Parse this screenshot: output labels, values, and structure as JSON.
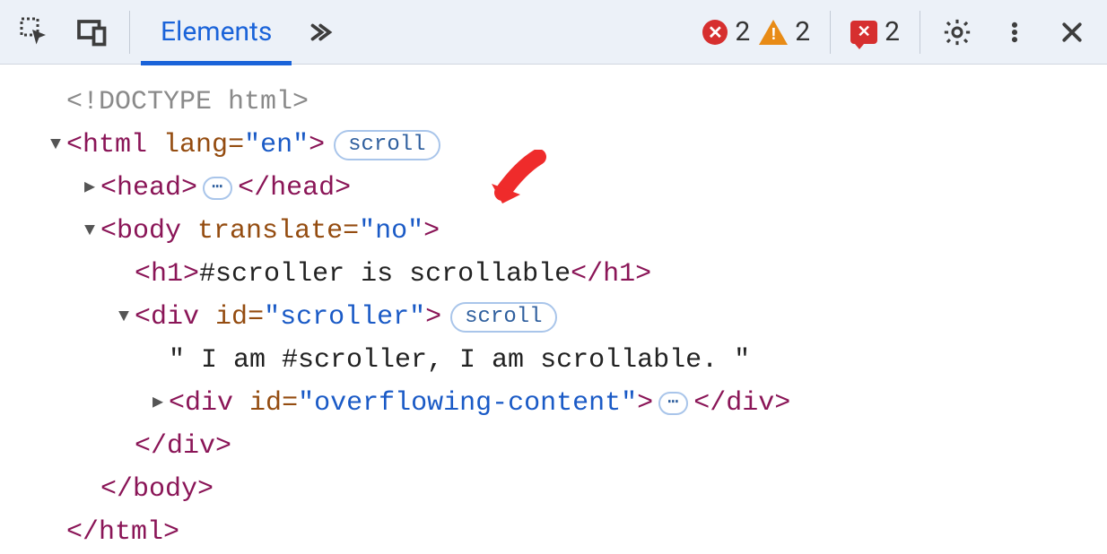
{
  "toolbar": {
    "tab_elements": "Elements",
    "errors_count": "2",
    "warnings_count": "2",
    "issues_count": "2"
  },
  "badges": {
    "scroll": "scroll",
    "ellipsis": "⋯"
  },
  "dom": {
    "doctype": "<!DOCTYPE html>",
    "html_open_tag": "html",
    "html_lang_attr": "lang",
    "html_lang_val": "\"en\"",
    "head_tag": "head",
    "body_tag": "body",
    "body_attr": "translate",
    "body_val": "\"no\"",
    "h1_tag": "h1",
    "h1_text": "#scroller is scrollable",
    "div_tag": "div",
    "id_attr": "id",
    "scroller_id": "\"scroller\"",
    "scroller_text": "\" I am #scroller, I am scrollable. \"",
    "overflow_id": "\"overflowing-content\"",
    "close_div": "</div>",
    "close_body": "</body>",
    "close_html": "</html>",
    "close_head": "</head>",
    "close_h1": "</h1>"
  }
}
